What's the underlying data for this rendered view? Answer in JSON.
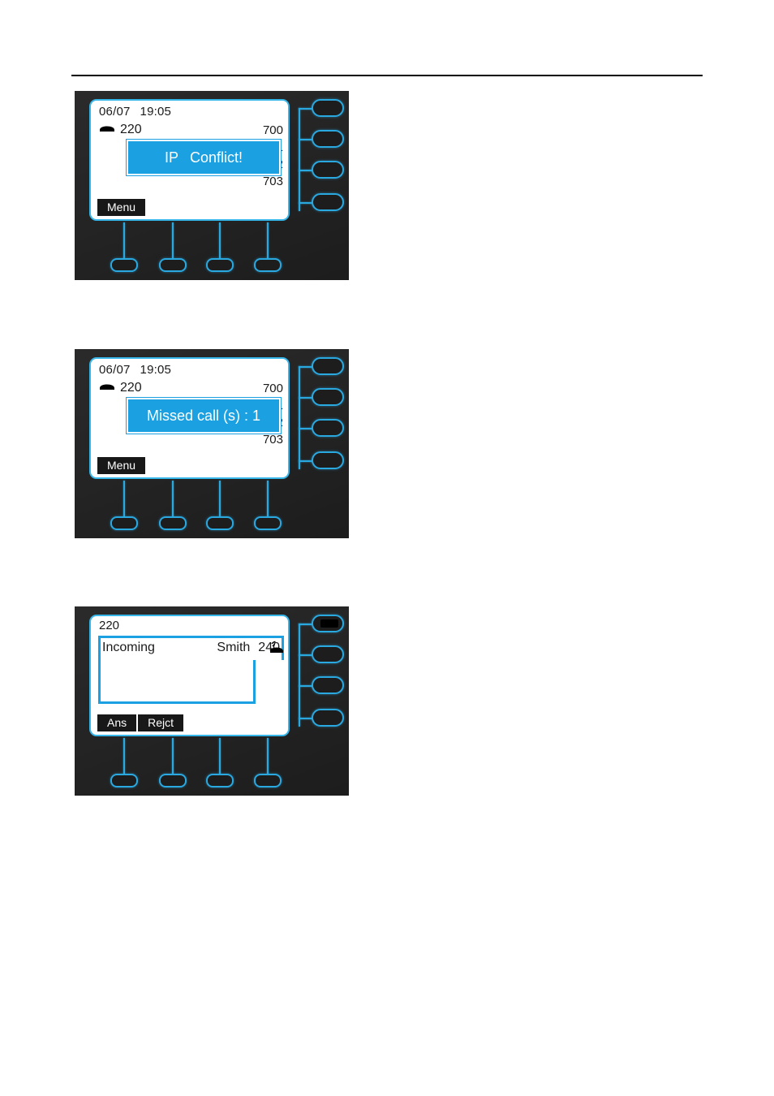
{
  "page": {
    "has_horizontal_rule": true,
    "background_color": "#ffffff"
  },
  "colors": {
    "phone_body": "#232323",
    "accent_blue": "#2aa8e0",
    "highlight_blue": "#1ba1e2",
    "screen_background": "#ffffff",
    "softkey_background": "#181818",
    "text_dark": "#1a1a1a"
  },
  "figures": [
    {
      "id": "ip-conflict",
      "screen_type": "idle",
      "statusbar": {
        "date": "06/07",
        "time": "19:05"
      },
      "account": {
        "icon": "handset-icon",
        "extension": "220"
      },
      "line_labels": [
        "700",
        "01",
        "02",
        "703"
      ],
      "popup": {
        "text_left": "IP",
        "text_right": "Conflict!",
        "full_text": "IP   Conflict!"
      },
      "softkeys": [
        "Menu"
      ],
      "line_keys": [
        {
          "label": "",
          "active": false
        },
        {
          "label": "",
          "active": false
        },
        {
          "label": "",
          "active": false
        },
        {
          "label": "",
          "active": false
        }
      ],
      "bottom_keys": [
        "",
        "",
        "",
        ""
      ]
    },
    {
      "id": "missed-call",
      "screen_type": "idle",
      "statusbar": {
        "date": "06/07",
        "time": "19:05"
      },
      "account": {
        "icon": "handset-icon",
        "extension": "220"
      },
      "line_labels": [
        "700",
        "01",
        "02",
        "703"
      ],
      "popup": {
        "full_text": "Missed call (s) : 1"
      },
      "softkeys": [
        "Menu"
      ],
      "line_keys": [
        {
          "label": "",
          "active": false
        },
        {
          "label": "",
          "active": false
        },
        {
          "label": "",
          "active": false
        },
        {
          "label": "",
          "active": false
        }
      ],
      "bottom_keys": [
        "",
        "",
        "",
        ""
      ]
    },
    {
      "id": "incoming-call",
      "screen_type": "incoming",
      "callee_id": "220",
      "call": {
        "state_label": "Incoming",
        "caller_name": "Smith",
        "caller_number": "240",
        "icon": "incoming-call-icon"
      },
      "softkeys": [
        "Ans",
        "Rejct"
      ],
      "line_keys": [
        {
          "label": "",
          "active": true
        },
        {
          "label": "",
          "active": false
        },
        {
          "label": "",
          "active": false
        },
        {
          "label": "",
          "active": false
        }
      ],
      "bottom_keys": [
        "",
        "",
        "",
        ""
      ]
    }
  ]
}
